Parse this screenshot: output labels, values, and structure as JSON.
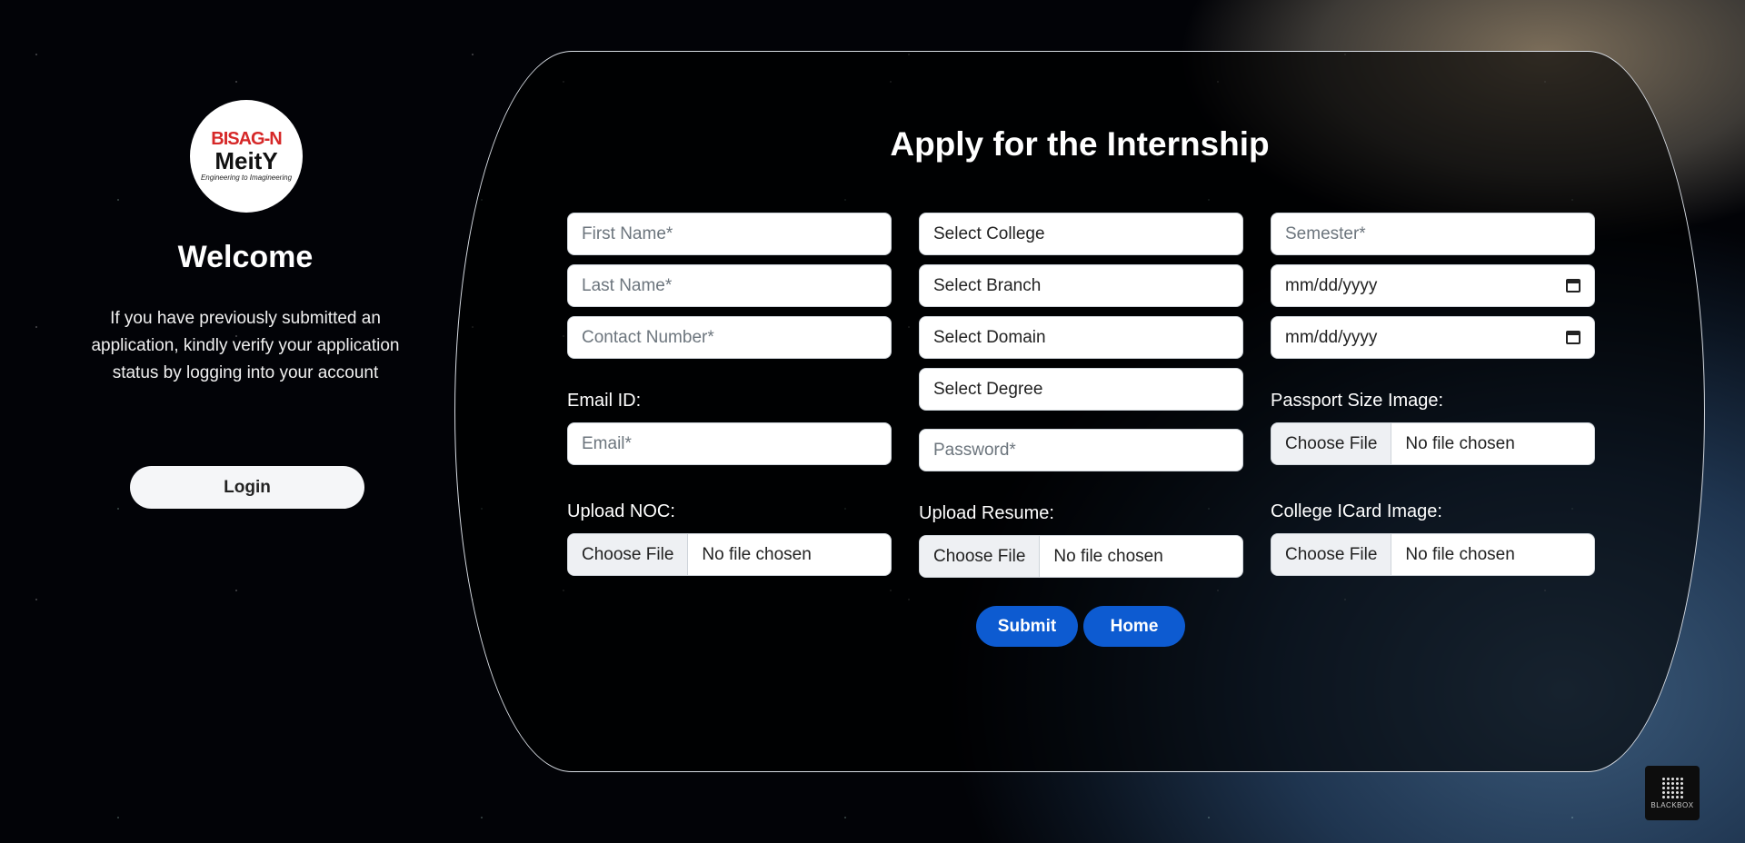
{
  "sidebar": {
    "logo": {
      "line1": "BISAG-N",
      "line2": "MeitY",
      "line3": "Engineering to Imagineering"
    },
    "welcome": "Welcome",
    "info": "If you have previously submitted an application, kindly verify your application status by logging into your account",
    "login_label": "Login"
  },
  "form": {
    "title": "Apply for the Internship",
    "first_name_placeholder": "First Name*",
    "last_name_placeholder": "Last Name*",
    "contact_placeholder": "Contact Number*",
    "email_label": "Email ID:",
    "email_placeholder": "Email*",
    "noc_label": "Upload NOC:",
    "college_select": "Select College",
    "branch_select": "Select Branch",
    "domain_select": "Select Domain",
    "degree_select": "Select Degree",
    "password_placeholder": "Password*",
    "resume_label": "Upload Resume:",
    "semester_placeholder": "Semester*",
    "start_date": "mm/dd/yyyy",
    "end_date": "mm/dd/yyyy",
    "passport_label": "Passport Size Image:",
    "icard_label": "College ICard Image:",
    "choose_file": "Choose File",
    "no_file": "No file chosen",
    "submit_label": "Submit",
    "home_label": "Home"
  },
  "badge": {
    "text": "BLACKBOX"
  },
  "colors": {
    "accent": "#0d5bd1",
    "background": "#020307"
  }
}
